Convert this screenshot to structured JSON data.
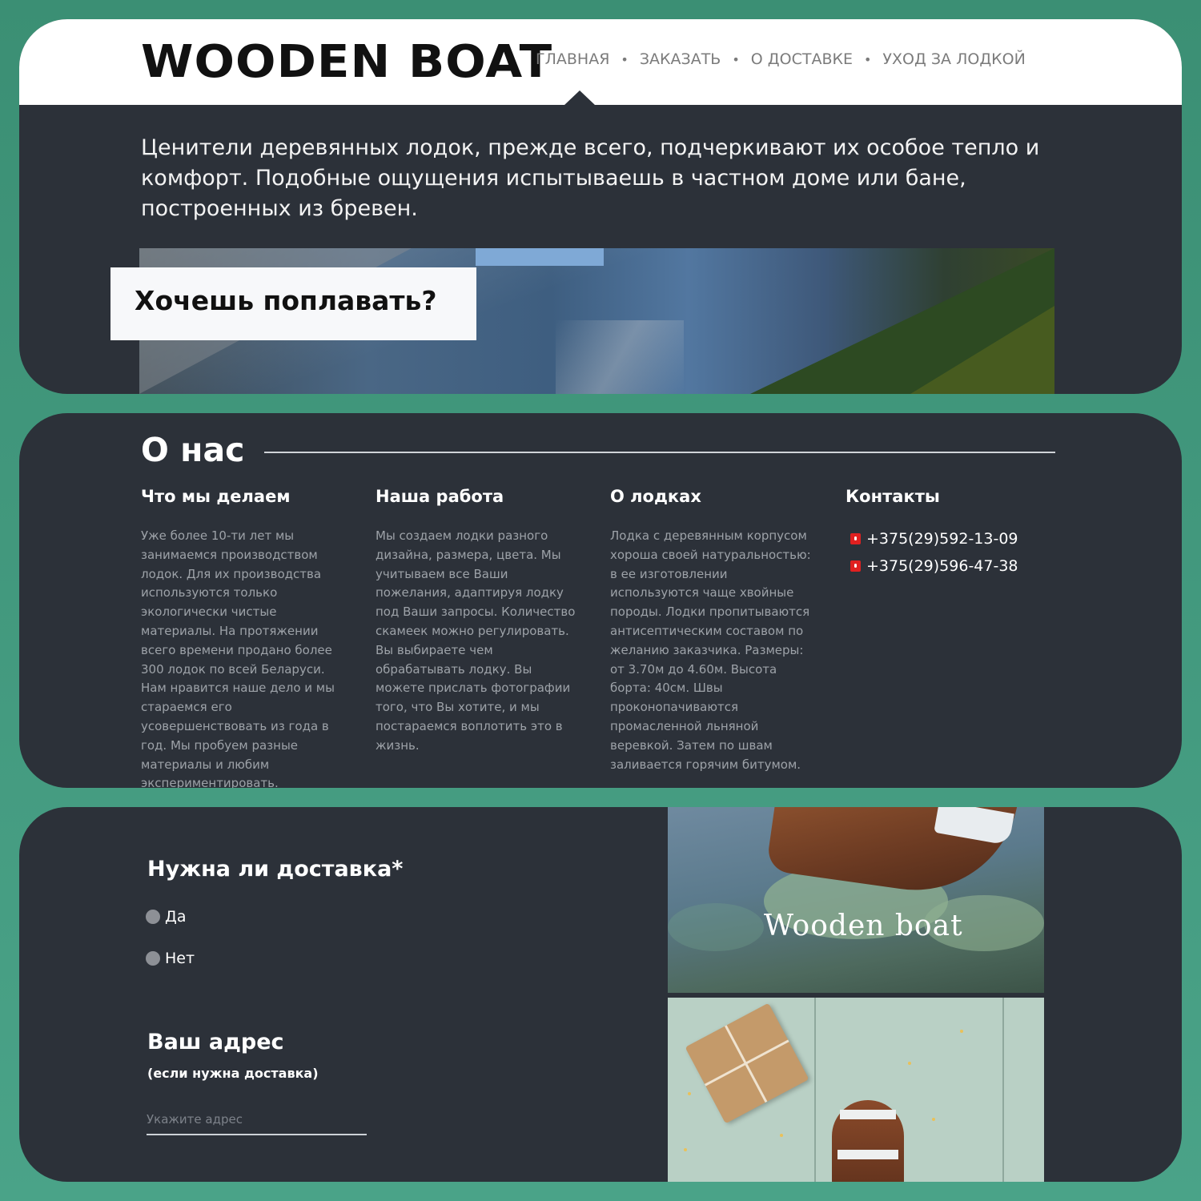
{
  "brand": {
    "logo": "WOODEN BOAT"
  },
  "nav": {
    "items": [
      "ГЛАВНАЯ",
      "ЗАКАЗАТЬ",
      "О ДОСТАВКЕ",
      "УХОД ЗА ЛОДКОЙ"
    ],
    "separator": "•"
  },
  "hero": {
    "intro": "Ценители деревянных лодок, прежде всего, подчеркивают их особое тепло и комфорт. Подобные ощущения испытываешь в частном доме или бане, построенных из бревен.",
    "cta": "Хочешь поплавать?"
  },
  "about": {
    "title": "О нас",
    "columns": [
      {
        "heading": "Что мы делаем",
        "text": "Уже более 10-ти лет мы занимаемся производством лодок. Для их производства используются только экологически чистые материалы. На протяжении всего времени продано более 300 лодок по всей Беларуси. Нам нравится наше дело и мы стараемся его усовершенствовать из года в год. Мы пробуем разные материалы и любим экспериментировать."
      },
      {
        "heading": "Наша работа",
        "text": "Мы создаем лодки разного дизайна, размера, цвета. Мы учитываем все Ваши пожелания, адаптируя лодку под Ваши запросы. Количество скамеек можно регулировать. Вы выбираете чем обрабатывать лодку. Вы можете прислать фотографии того, что Вы хотите, и мы постараемся воплотить это в жизнь."
      },
      {
        "heading": "О лодках",
        "text": "Лодка с деревянным корпусом хороша своей натуральностью: в ее изготовлении используются чаще хвойные породы. Лодки пропитываются антисептическим составом по желанию заказчика. Размеры: от 3.70м до 4.60м. Высота борта: 40см. Швы проконопачиваются промасленной льняной веревкой. Затем по швам заливается горячим битумом."
      }
    ],
    "contacts": {
      "heading": "Контакты",
      "phones": [
        "+375(29)592-13-09",
        "+375(29)596-47-38"
      ],
      "icon": "phone-icon"
    }
  },
  "delivery": {
    "question": "Нужна ли доставка*",
    "options": [
      "Да",
      "Нет"
    ],
    "address_title": "Ваш адрес",
    "address_note": "(если нужна доставка)",
    "address_placeholder": "Укажите адрес"
  },
  "gallery": {
    "caption": "Wooden boat"
  },
  "colors": {
    "background": "#3b8f74",
    "panel": "#2c3139",
    "header": "#ffffff",
    "accent_phone": "#e02020",
    "muted_text": "#9da2a8"
  }
}
